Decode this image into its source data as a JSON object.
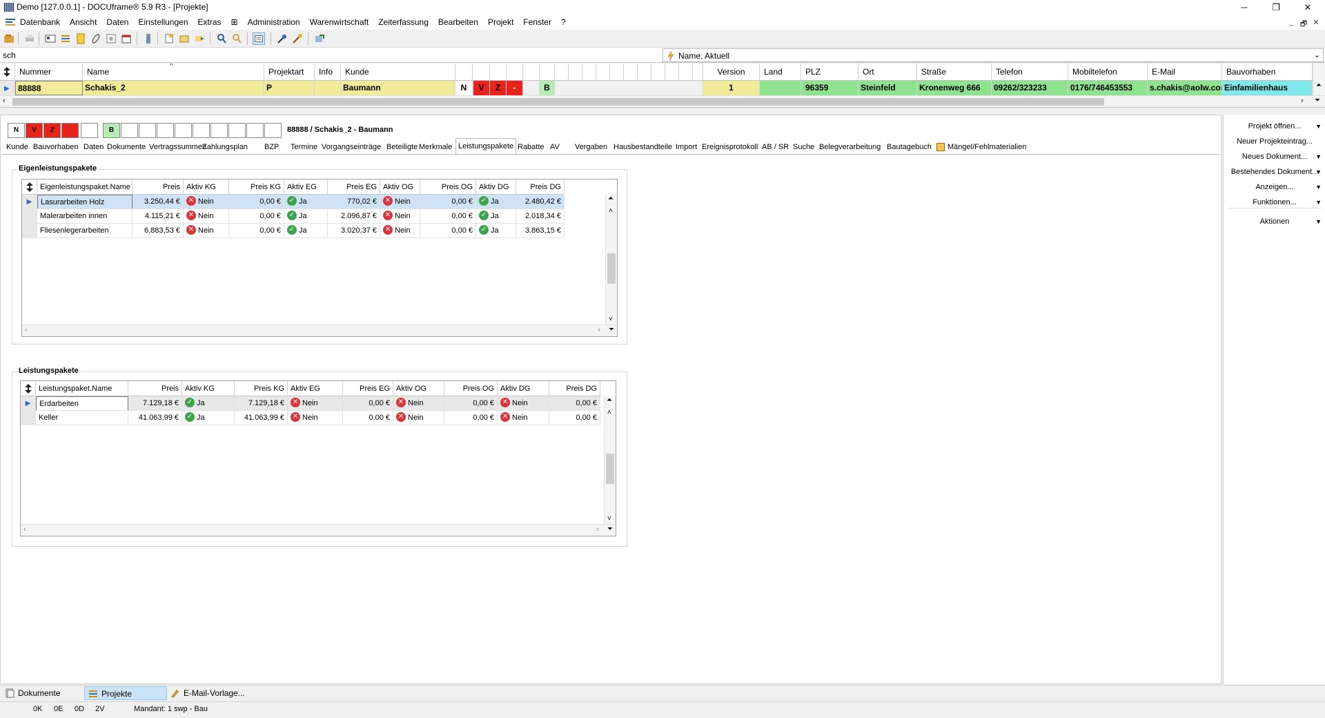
{
  "window": {
    "title": "Demo [127.0.0.1] - DOCUframe® 5.9 R3 - [Projekte]",
    "controls": {
      "minimize": "─",
      "maximize": "❐",
      "close": "✕"
    },
    "mdi_controls": {
      "minimize": "_",
      "restore": "🗗",
      "close": "✕"
    }
  },
  "menu": [
    "Datenbank",
    "Ansicht",
    "Daten",
    "Einstellungen",
    "Extras",
    "⊞",
    "Administration",
    "Warenwirtschaft",
    "Zeiterfassung",
    "Bearbeiten",
    "Projekt",
    "Fenster",
    "?"
  ],
  "search": {
    "value": "sch",
    "sort_label": "Name, Aktuell"
  },
  "project_grid": {
    "headers": {
      "nummer": "Nummer",
      "name": "Name",
      "projektart": "Projektart",
      "info": "Info",
      "kunde": "Kunde",
      "version": "Version",
      "land": "Land",
      "plz": "PLZ",
      "ort": "Ort",
      "strasse": "Straße",
      "telefon": "Telefon",
      "mobil": "Mobiltelefon",
      "email": "E-Mail",
      "bauvorhaben": "Bauvorhaben"
    },
    "row": {
      "nummer": "88888",
      "name": "Schakis_2",
      "projektart": "P",
      "info": "",
      "kunde": "Baumann",
      "flag_n": "N",
      "flag_v": "V",
      "flag_z": "Z",
      "flag_dash": "-",
      "flag_b": "B",
      "version": "1",
      "land": "",
      "plz": "96359",
      "ort": "Steinfeld",
      "strasse": "Kronenweg 666",
      "telefon": "09262/323233",
      "mobil": "0176/746453553",
      "email": "s.chakis@aolw.com",
      "bauvorhaben": "Einfamilienhaus"
    }
  },
  "detail": {
    "flags": [
      "N",
      "V",
      "Z",
      "",
      "",
      "B",
      "",
      "",
      "",
      "",
      "",
      "",
      "",
      "",
      "",
      ""
    ],
    "heading": "88888 / Schakis_2 - Baumann",
    "tabs": [
      "Kunde",
      "Bauvorhaben",
      "Daten",
      "Dokumente",
      "Vertragssummen",
      "Zahlungsplan",
      "BZP",
      "Termine",
      "Vorgangseinträge",
      "Beteiligte",
      "Merkmale",
      "Leistungspakete",
      "Rabatte",
      "AV",
      "Vergaben",
      "Hausbestandteile",
      "Import",
      "Ereignisprotokoll",
      "AB / SR",
      "Suche",
      "Belegverarbeitung",
      "Bautagebuch",
      "Mängel/Fehlmaterialien"
    ],
    "active_tab": "Leistungspakete",
    "eigen": {
      "title": "Eigenleistungspakete",
      "headers": [
        "Eigenleistungspaket.Name",
        "Preis",
        "Aktiv KG",
        "Preis KG",
        "Aktiv EG",
        "Preis EG",
        "Aktiv OG",
        "Preis OG",
        "Aktiv DG",
        "Preis DG"
      ],
      "rows": [
        {
          "name": "Lasurarbeiten Holz",
          "preis": "3.250,44 €",
          "akg": "Nein",
          "pkg": "0,00 €",
          "aeg": "Ja",
          "peg": "770,02 €",
          "aog": "Nein",
          "pog": "0,00 €",
          "adg": "Ja",
          "pdg": "2.480,42 €"
        },
        {
          "name": "Malerarbeiten innen",
          "preis": "4.115,21 €",
          "akg": "Nein",
          "pkg": "0,00 €",
          "aeg": "Ja",
          "peg": "2.096,87 €",
          "aog": "Nein",
          "pog": "0,00 €",
          "adg": "Ja",
          "pdg": "2.018,34 €"
        },
        {
          "name": "Fliesenlegerarbeiten",
          "preis": "6.883,53 €",
          "akg": "Nein",
          "pkg": "0,00 €",
          "aeg": "Ja",
          "peg": "3.020,37 €",
          "aog": "Nein",
          "pog": "0,00 €",
          "adg": "Ja",
          "pdg": "3.863,15 €"
        }
      ]
    },
    "leist": {
      "title": "Leistungspakete",
      "headers": [
        "Leistungspaket.Name",
        "Preis",
        "Aktiv KG",
        "Preis KG",
        "Aktiv EG",
        "Preis EG",
        "Aktiv OG",
        "Preis OG",
        "Aktiv DG",
        "Preis DG"
      ],
      "rows": [
        {
          "name": "Erdarbeiten",
          "preis": "7.129,18 €",
          "akg": "Ja",
          "pkg": "7.129,18 €",
          "aeg": "Nein",
          "peg": "0,00 €",
          "aog": "Nein",
          "pog": "0,00 €",
          "adg": "Nein",
          "pdg": "0,00 €"
        },
        {
          "name": "Keller",
          "preis": "41.063,99 €",
          "akg": "Ja",
          "pkg": "41.063,99 €",
          "aeg": "Nein",
          "peg": "0,00 €",
          "aog": "Nein",
          "pog": "0,00 €",
          "adg": "Nein",
          "pdg": "0,00 €"
        }
      ]
    }
  },
  "right_panel": [
    "Projekt öffnen...",
    "Neuer Projekteintrag...",
    "Neues Dokument...",
    "Bestehendes Dokument...",
    "Anzeigen...",
    "Funktionen...",
    "Aktionen"
  ],
  "window_tabs": [
    "Dokumente",
    "Projekte",
    "E-Mail-Vorlage..."
  ],
  "status": {
    "k": "0K",
    "e": "0E",
    "d": "0D",
    "v": "2V",
    "mandant": "Mandant: 1 swp - Bau"
  },
  "colors": {
    "yellow": "#f0ec99",
    "green": "#8fe28f",
    "cyan": "#7fe9ea",
    "red": "#e8231c",
    "selection": "#cfe3f7"
  }
}
